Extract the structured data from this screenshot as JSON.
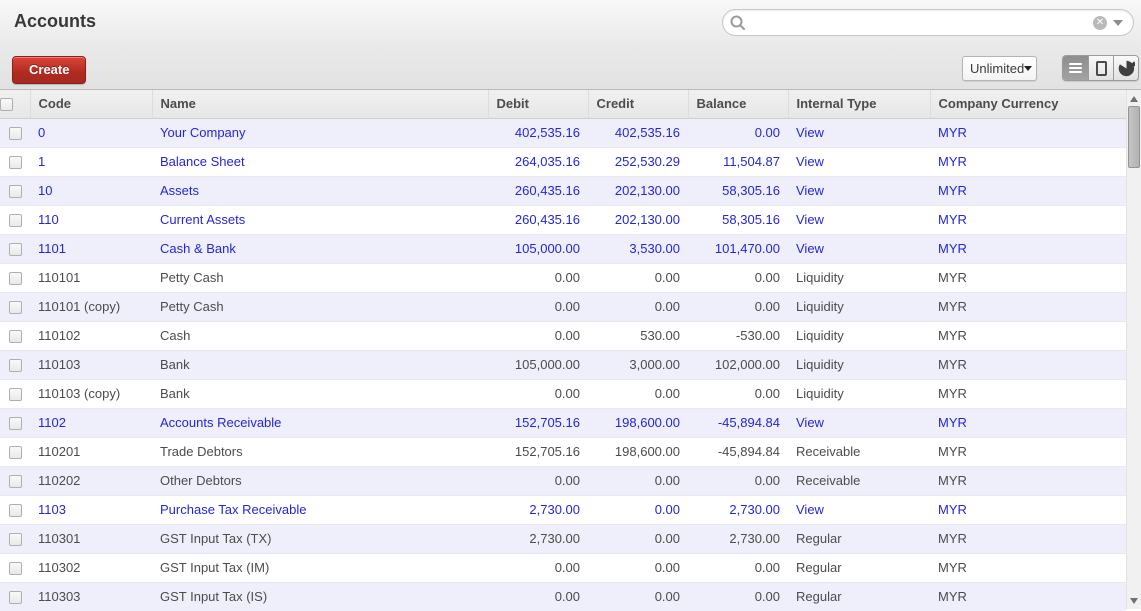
{
  "page_title": "Accounts",
  "search": {
    "value": "",
    "placeholder": ""
  },
  "toolbar": {
    "create_label": "Create",
    "pager_label": "Unlimited"
  },
  "colors": {
    "link_blue": "#2525dd",
    "create_button_red": "#b02b20",
    "alt_row": "#eeeffa"
  },
  "table": {
    "columns": {
      "code": "Code",
      "name": "Name",
      "debit": "Debit",
      "credit": "Credit",
      "balance": "Balance",
      "internal_type": "Internal Type",
      "company_currency": "Company Currency"
    },
    "rows": [
      {
        "code": "0",
        "name": "Your Company",
        "debit": "402,535.16",
        "credit": "402,535.16",
        "balance": "0.00",
        "internal_type": "View",
        "currency": "MYR",
        "link": true
      },
      {
        "code": "1",
        "name": "Balance Sheet",
        "debit": "264,035.16",
        "credit": "252,530.29",
        "balance": "11,504.87",
        "internal_type": "View",
        "currency": "MYR",
        "link": true
      },
      {
        "code": "10",
        "name": "Assets",
        "debit": "260,435.16",
        "credit": "202,130.00",
        "balance": "58,305.16",
        "internal_type": "View",
        "currency": "MYR",
        "link": true
      },
      {
        "code": "110",
        "name": "Current Assets",
        "debit": "260,435.16",
        "credit": "202,130.00",
        "balance": "58,305.16",
        "internal_type": "View",
        "currency": "MYR",
        "link": true
      },
      {
        "code": "1101",
        "name": "Cash & Bank",
        "debit": "105,000.00",
        "credit": "3,530.00",
        "balance": "101,470.00",
        "internal_type": "View",
        "currency": "MYR",
        "link": true
      },
      {
        "code": "110101",
        "name": "Petty Cash",
        "debit": "0.00",
        "credit": "0.00",
        "balance": "0.00",
        "internal_type": "Liquidity",
        "currency": "MYR",
        "link": false
      },
      {
        "code": "110101 (copy)",
        "name": "Petty Cash",
        "debit": "0.00",
        "credit": "0.00",
        "balance": "0.00",
        "internal_type": "Liquidity",
        "currency": "MYR",
        "link": false
      },
      {
        "code": "110102",
        "name": "Cash",
        "debit": "0.00",
        "credit": "530.00",
        "balance": "-530.00",
        "internal_type": "Liquidity",
        "currency": "MYR",
        "link": false
      },
      {
        "code": "110103",
        "name": "Bank",
        "debit": "105,000.00",
        "credit": "3,000.00",
        "balance": "102,000.00",
        "internal_type": "Liquidity",
        "currency": "MYR",
        "link": false
      },
      {
        "code": "110103 (copy)",
        "name": "Bank",
        "debit": "0.00",
        "credit": "0.00",
        "balance": "0.00",
        "internal_type": "Liquidity",
        "currency": "MYR",
        "link": false
      },
      {
        "code": "1102",
        "name": "Accounts Receivable",
        "debit": "152,705.16",
        "credit": "198,600.00",
        "balance": "-45,894.84",
        "internal_type": "View",
        "currency": "MYR",
        "link": true
      },
      {
        "code": "110201",
        "name": "Trade Debtors",
        "debit": "152,705.16",
        "credit": "198,600.00",
        "balance": "-45,894.84",
        "internal_type": "Receivable",
        "currency": "MYR",
        "link": false
      },
      {
        "code": "110202",
        "name": "Other Debtors",
        "debit": "0.00",
        "credit": "0.00",
        "balance": "0.00",
        "internal_type": "Receivable",
        "currency": "MYR",
        "link": false
      },
      {
        "code": "1103",
        "name": "Purchase Tax Receivable",
        "debit": "2,730.00",
        "credit": "0.00",
        "balance": "2,730.00",
        "internal_type": "View",
        "currency": "MYR",
        "link": true
      },
      {
        "code": "110301",
        "name": "GST Input Tax (TX)",
        "debit": "2,730.00",
        "credit": "0.00",
        "balance": "2,730.00",
        "internal_type": "Regular",
        "currency": "MYR",
        "link": false
      },
      {
        "code": "110302",
        "name": "GST Input Tax (IM)",
        "debit": "0.00",
        "credit": "0.00",
        "balance": "0.00",
        "internal_type": "Regular",
        "currency": "MYR",
        "link": false
      },
      {
        "code": "110303",
        "name": "GST Input Tax (IS)",
        "debit": "0.00",
        "credit": "0.00",
        "balance": "0.00",
        "internal_type": "Regular",
        "currency": "MYR",
        "link": false
      }
    ]
  }
}
